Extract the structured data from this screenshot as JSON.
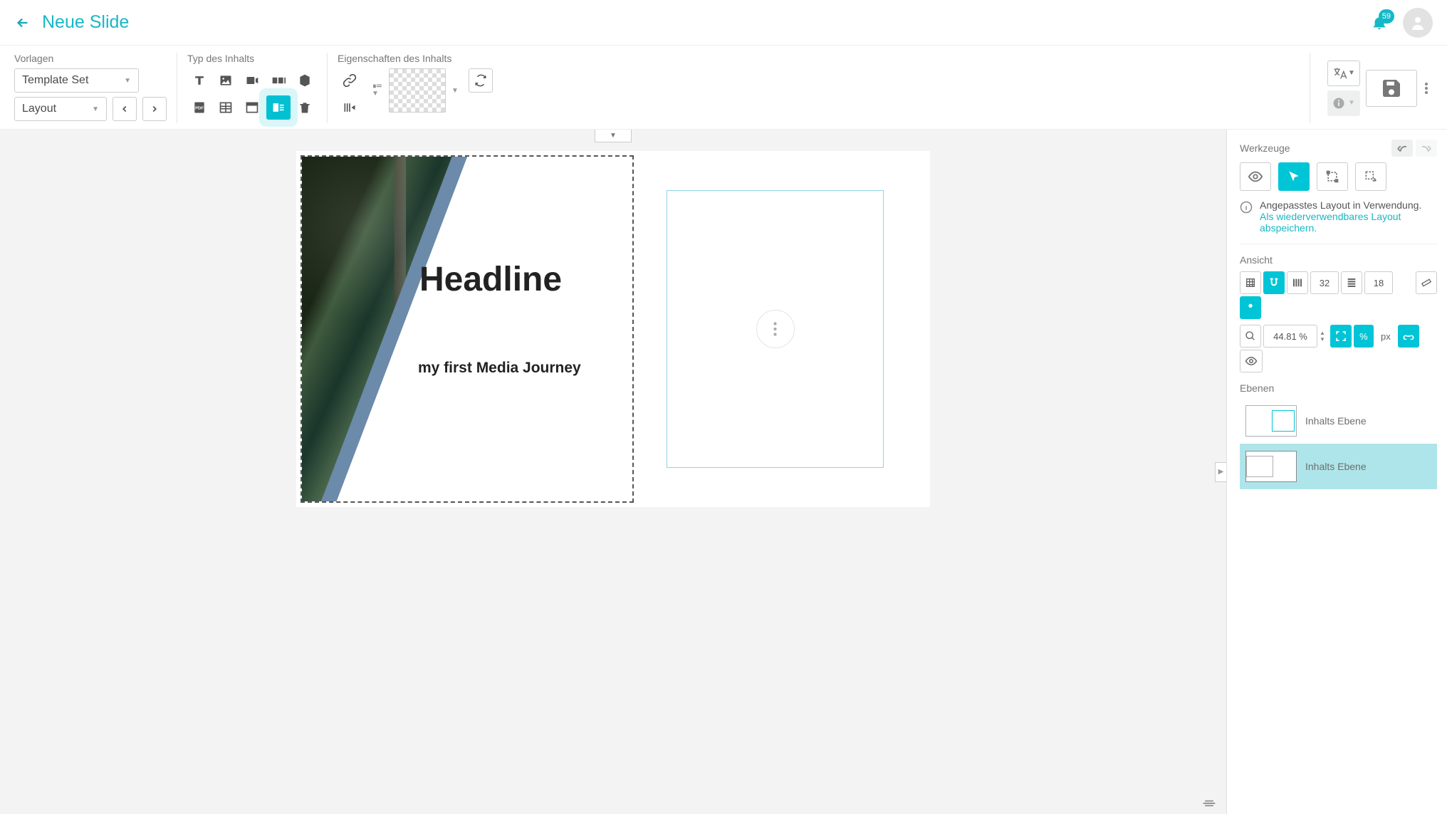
{
  "header": {
    "title": "Neue Slide",
    "badge": "59"
  },
  "toolbar": {
    "templates": {
      "label": "Vorlagen",
      "dropdown1": "Template Set",
      "dropdown2": "Layout"
    },
    "contentType": {
      "label": "Typ des Inhalts"
    },
    "contentProps": {
      "label": "Eigenschaften des Inhalts"
    }
  },
  "slide": {
    "headline": "Headline",
    "subline": "my first Media Journey"
  },
  "panel": {
    "tools": {
      "label": "Werkzeuge"
    },
    "info": {
      "text": "Angepasstes Layout in Verwendung. ",
      "link": "Als wiederverwendbares Layout abspeichern."
    },
    "view": {
      "label": "Ansicht",
      "grid1": "32",
      "grid2": "18",
      "zoom": "44.81 %",
      "unitPercentShort": "%",
      "unitPx": "px"
    },
    "layers": {
      "label": "Ebenen",
      "items": [
        {
          "name": "Inhalts Ebene"
        },
        {
          "name": "Inhalts Ebene"
        }
      ]
    }
  }
}
